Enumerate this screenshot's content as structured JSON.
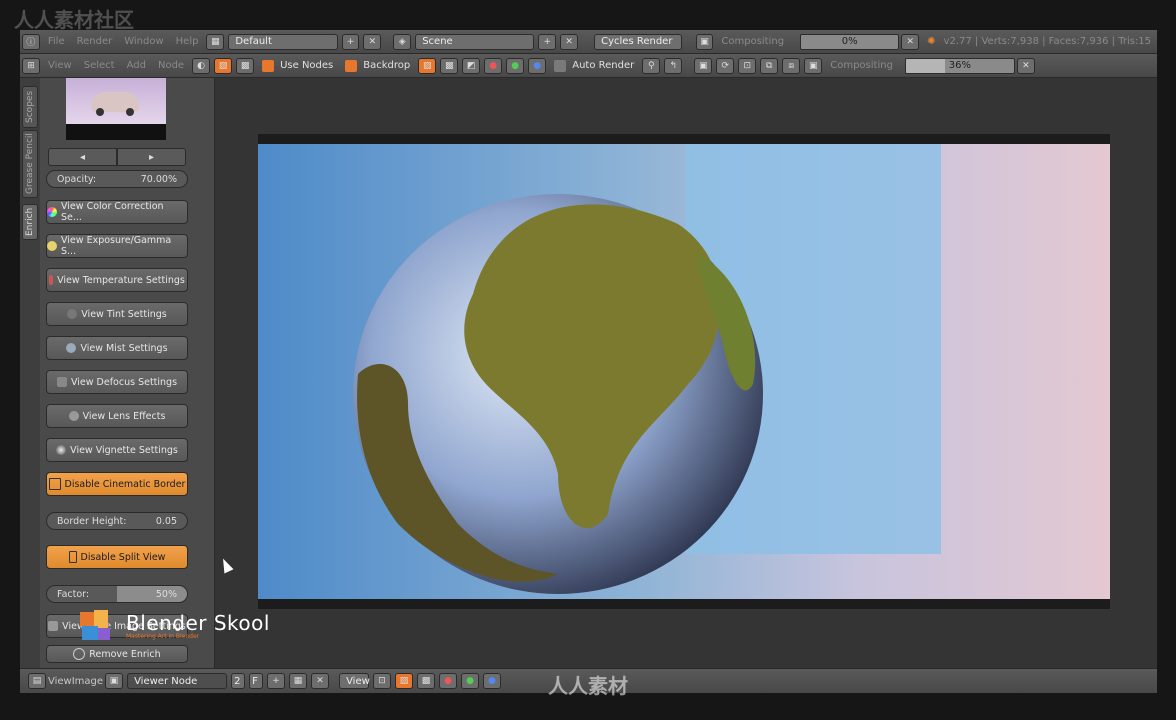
{
  "watermark_top": "人人素材社区",
  "watermark_bottom": "人人素材",
  "info_header": {
    "menus": [
      "File",
      "Render",
      "Window",
      "Help"
    ],
    "layout": "Default",
    "scene": "Scene",
    "engine": "Cycles Render",
    "compositing_label": "Compositing",
    "progress": "0%",
    "stats": "v2.77 | Verts:7,938 | Faces:7,936 | Tris:15"
  },
  "node_header": {
    "menus": [
      "View",
      "Select",
      "Add",
      "Node"
    ],
    "use_nodes": "Use Nodes",
    "backdrop": "Backdrop",
    "auto_render": "Auto Render",
    "compositing_label": "Compositing",
    "progress": "36%"
  },
  "side_tabs": [
    "Scopes",
    "Grease Pencil",
    "Enrich"
  ],
  "panel": {
    "opacity_label": "Opacity:",
    "opacity_value": "70.00%",
    "buttons": [
      "View Color Correction Se...",
      "View Exposure/Gamma S...",
      "View Temperature Settings",
      "View Tint Settings",
      "View Mist Settings",
      "View Defocus Settings",
      "View Lens Effects",
      "View Vignette Settings"
    ],
    "cinematic": "Disable Cinematic Border",
    "border_label": "Border Height:",
    "border_value": "0.05",
    "split": "Disable Split View",
    "factor_label": "Factor:",
    "factor_value": "50%",
    "save": "View Save Image Settings",
    "remove": "Remove Enrich"
  },
  "logo": {
    "name": "Blender Skool",
    "tagline": "Mastering Art in Blender"
  },
  "bottom_header": {
    "menus": [
      "View",
      "Image"
    ],
    "image_name": "Viewer Node",
    "slot": "2",
    "f": "F",
    "view": "View"
  }
}
